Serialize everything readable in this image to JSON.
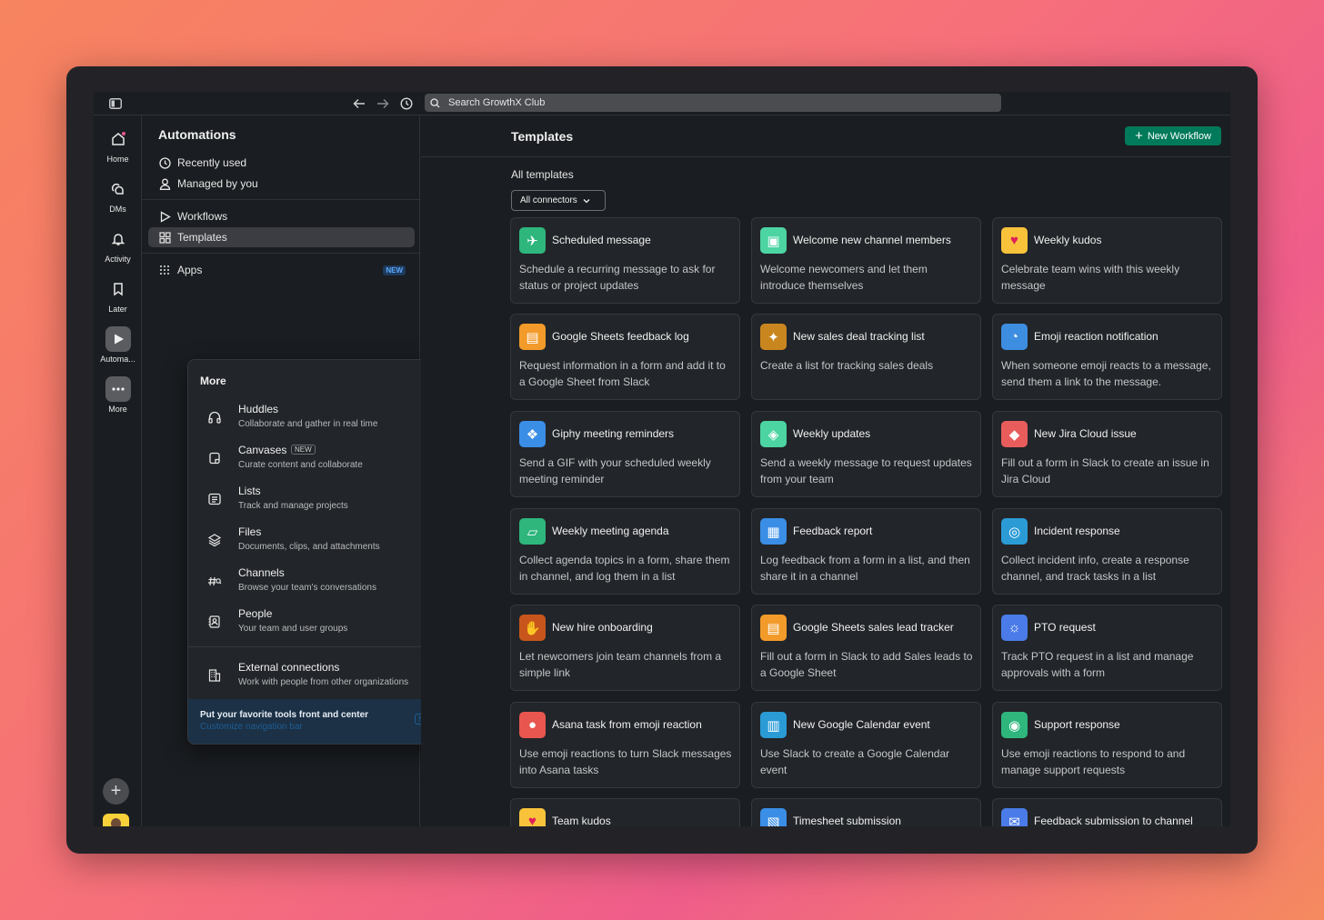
{
  "topbar": {
    "search_placeholder": "Search GrowthX Club"
  },
  "rail": {
    "items": [
      {
        "label": "Home",
        "icon": "home-icon"
      },
      {
        "label": "DMs",
        "icon": "dms-icon"
      },
      {
        "label": "Activity",
        "icon": "bell-icon"
      },
      {
        "label": "Later",
        "icon": "bookmark-icon"
      },
      {
        "label": "Automa...",
        "icon": "play-icon"
      },
      {
        "label": "More",
        "icon": "more-icon"
      }
    ]
  },
  "sidebar": {
    "title": "Automations",
    "items": [
      {
        "label": "Recently used",
        "icon": "clock-icon"
      },
      {
        "label": "Managed by you",
        "icon": "person-icon"
      },
      {
        "label": "Workflows",
        "icon": "play-outline-icon"
      },
      {
        "label": "Templates",
        "icon": "grid-icon"
      },
      {
        "label": "Apps",
        "icon": "apps-icon",
        "badge": "NEW"
      }
    ]
  },
  "more_panel": {
    "title": "More",
    "items": [
      {
        "title": "Huddles",
        "desc": "Collaborate and gather in real time",
        "icon": "headphones-icon"
      },
      {
        "title": "Canvases",
        "desc": "Curate content and collaborate",
        "icon": "canvas-icon",
        "badge": "NEW"
      },
      {
        "title": "Lists",
        "desc": "Track and manage projects",
        "icon": "list-icon"
      },
      {
        "title": "Files",
        "desc": "Documents, clips, and attachments",
        "icon": "layers-icon"
      },
      {
        "title": "Channels",
        "desc": "Browse your team's conversations",
        "icon": "channels-icon"
      },
      {
        "title": "People",
        "desc": "Your team and user groups",
        "icon": "people-icon"
      },
      {
        "title": "External connections",
        "desc": "Work with people from other organizations",
        "icon": "building-icon"
      }
    ],
    "footer": {
      "title": "Put your favorite tools front and center",
      "link": "Customize navigation bar",
      "badge": "NEW"
    }
  },
  "main": {
    "title": "Templates",
    "new_workflow": "New Workflow",
    "section_label": "All templates",
    "connector_filter": "All connectors",
    "cards": [
      {
        "title": "Scheduled message",
        "desc": "Schedule a recurring message to ask for status or project updates",
        "icon": "paper-plane-icon",
        "color": "#2eb67d"
      },
      {
        "title": "Welcome new channel members",
        "desc": "Welcome newcomers and let them introduce themselves",
        "icon": "gift-icon",
        "color": "#4cd4a3"
      },
      {
        "title": "Weekly kudos",
        "desc": "Celebrate team wins with this weekly message",
        "icon": "heart-icon",
        "color": "#f8c33b"
      },
      {
        "title": "Google Sheets feedback log",
        "desc": "Request information in a form and add it to a Google Sheet from Slack",
        "icon": "sheets-icon",
        "color": "#f29b2a"
      },
      {
        "title": "New sales deal tracking list",
        "desc": "Create a list for tracking sales deals",
        "icon": "deal-icon",
        "color": "#c9861f"
      },
      {
        "title": "Emoji reaction notification",
        "desc": "When someone emoji reacts to a message, send them a link to the message.",
        "icon": "emoji-bell-icon",
        "color": "#3d8de0"
      },
      {
        "title": "Giphy meeting reminders",
        "desc": "Send a GIF with your scheduled weekly meeting reminder",
        "icon": "giphy-icon",
        "color": "#3a8ee6"
      },
      {
        "title": "Weekly updates",
        "desc": "Send a weekly message to request updates from your team",
        "icon": "megaphone-icon",
        "color": "#4cd4a3"
      },
      {
        "title": "New Jira Cloud issue",
        "desc": "Fill out a form in Slack to create an issue in Jira Cloud",
        "icon": "jira-icon",
        "color": "#e85c5c"
      },
      {
        "title": "Weekly meeting agenda",
        "desc": "Collect agenda topics in a form, share them in channel, and log them in a list",
        "icon": "agenda-icon",
        "color": "#2eb67d"
      },
      {
        "title": "Feedback report",
        "desc": "Log feedback from a form in a list, and then share it in a channel",
        "icon": "report-icon",
        "color": "#3a8ee6"
      },
      {
        "title": "Incident response",
        "desc": "Collect incident info, create a response channel, and track tasks in a list",
        "icon": "lifebuoy-icon",
        "color": "#2b9bd6"
      },
      {
        "title": "New hire onboarding",
        "desc": "Let newcomers join team channels from a simple link",
        "icon": "wave-icon",
        "color": "#c8561c"
      },
      {
        "title": "Google Sheets sales lead tracker",
        "desc": "Fill out a form in Slack to add Sales leads to a Google Sheet",
        "icon": "sheets-icon",
        "color": "#f29b2a"
      },
      {
        "title": "PTO request",
        "desc": "Track PTO request in a list and manage approvals with a form",
        "icon": "pto-icon",
        "color": "#4a7be8"
      },
      {
        "title": "Asana task from emoji reaction",
        "desc": "Use emoji reactions to turn Slack messages into Asana tasks",
        "icon": "asana-icon",
        "color": "#e8564f"
      },
      {
        "title": "New Google Calendar event",
        "desc": "Use Slack to create a Google Calendar event",
        "icon": "calendar-icon",
        "color": "#2b9bd6"
      },
      {
        "title": "Support response",
        "desc": "Use emoji reactions to respond to and manage support requests",
        "icon": "eyes-icon",
        "color": "#2eb67d"
      },
      {
        "title": "Team kudos",
        "desc": "",
        "icon": "heart-icon",
        "color": "#f8c33b"
      },
      {
        "title": "Timesheet submission",
        "desc": "",
        "icon": "timesheet-icon",
        "color": "#3a8ee6"
      },
      {
        "title": "Feedback submission to channel",
        "desc": "",
        "icon": "feedback-icon",
        "color": "#4a7be8"
      }
    ]
  }
}
